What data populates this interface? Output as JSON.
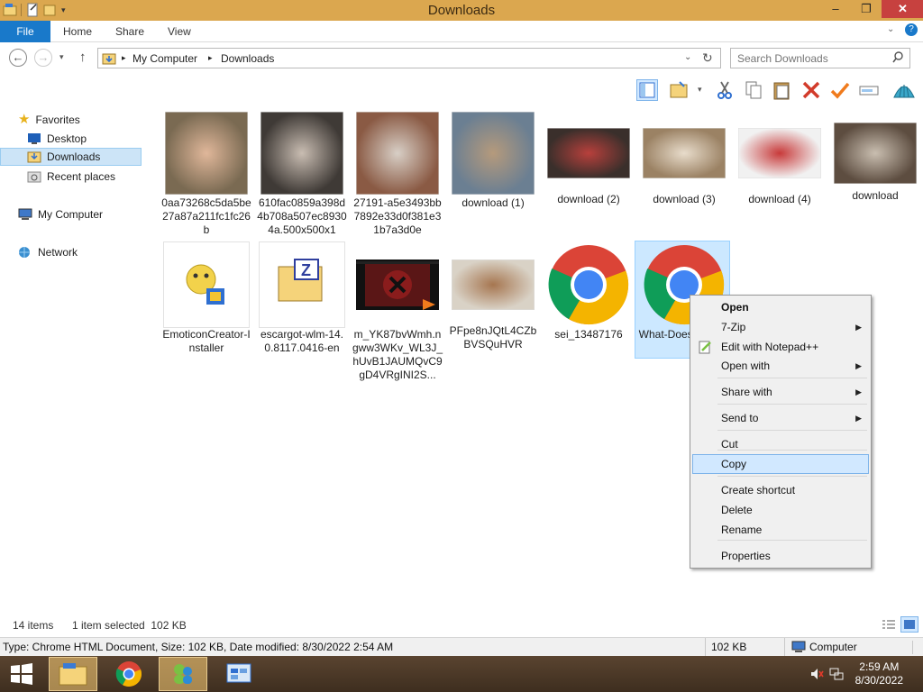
{
  "window": {
    "title": "Downloads"
  },
  "controls": {
    "minimize": "–",
    "restore": "❐",
    "close": "✕"
  },
  "ribbon": {
    "tabs": [
      "File",
      "Home",
      "Share",
      "View"
    ]
  },
  "address": {
    "segments": [
      "My Computer",
      "Downloads"
    ],
    "back": "←",
    "forward": "→",
    "up": "↑"
  },
  "search": {
    "placeholder": "Search Downloads"
  },
  "nav": {
    "favorites": "Favorites",
    "items": [
      "Desktop",
      "Downloads",
      "Recent places"
    ],
    "computer": "My Computer",
    "network": "Network"
  },
  "files": [
    {
      "name": "0aa73268c5da5be27a87a211fc1fc26b",
      "kind": "photo",
      "c1": "#7a6a52",
      "c2": "#e0b79a"
    },
    {
      "name": "610fac0859a398d4b708a507ec89304a.500x500x1",
      "kind": "photo",
      "c1": "#3f3a36",
      "c2": "#c9bdb2"
    },
    {
      "name": "27191-a5e3493bb7892e33d0f381e31b7a3d0e",
      "kind": "photo",
      "c1": "#8a5a44",
      "c2": "#d8cfc6"
    },
    {
      "name": "download (1)",
      "kind": "photo",
      "c1": "#6b7f92",
      "c2": "#b59a7c"
    },
    {
      "name": "download (2)",
      "kind": "photo",
      "c1": "#3a2f2b",
      "c2": "#b8403c"
    },
    {
      "name": "download (3)",
      "kind": "photo",
      "c1": "#9b8264",
      "c2": "#e8dccb"
    },
    {
      "name": "download (4)",
      "kind": "photo",
      "c1": "#f1f1f1",
      "c2": "#c83a3a"
    },
    {
      "name": "download",
      "kind": "photo",
      "c1": "#5d4d40",
      "c2": "#c9beb0"
    },
    {
      "name": "EmoticonCreator-Installer",
      "kind": "installer"
    },
    {
      "name": "escargot-wlm-14.0.8117.0416-en",
      "kind": "archive"
    },
    {
      "name": "m_YK87bvWmh.ngww3WKv_WL3J_hUvB1JAUMQvC9gD4VRgINI2S...",
      "kind": "video",
      "c1": "#5a1616",
      "c2": "#111111"
    },
    {
      "name": "PFpe8nJQtL4CZbBVSQuHVR",
      "kind": "photo",
      "c1": "#d9d2c6",
      "c2": "#a67650"
    },
    {
      "name": "sei_13487176",
      "kind": "chrome"
    },
    {
      "name": "What-Does-G-Mea",
      "kind": "chrome"
    }
  ],
  "context_menu": {
    "items": [
      {
        "label": "Open",
        "bold": true
      },
      {
        "label": "7-Zip",
        "submenu": true
      },
      {
        "label": "Edit with Notepad++"
      },
      {
        "label": "Open with",
        "submenu": true
      },
      {
        "label": "Share with",
        "submenu": true
      },
      {
        "label": "Send to",
        "submenu": true
      },
      {
        "label": "Cut"
      },
      {
        "label": "Copy",
        "highlighted": true
      },
      {
        "label": "Create shortcut"
      },
      {
        "label": "Delete"
      },
      {
        "label": "Rename"
      },
      {
        "label": "Properties"
      }
    ]
  },
  "status": {
    "count": "14 items",
    "selected": "1 item selected  102 KB"
  },
  "details": {
    "text": "Type: Chrome HTML Document, Size: 102 KB, Date modified: 8/30/2022 2:54 AM",
    "size": "102 KB",
    "location": "Computer"
  },
  "taskbar": {
    "time": "2:59 AM",
    "date": "8/30/2022"
  },
  "colors": {
    "titlebar": "#dba74f",
    "file_tab": "#1979ca",
    "selection": "#cce8ff",
    "menu_highlight": "#d1e8ff"
  }
}
